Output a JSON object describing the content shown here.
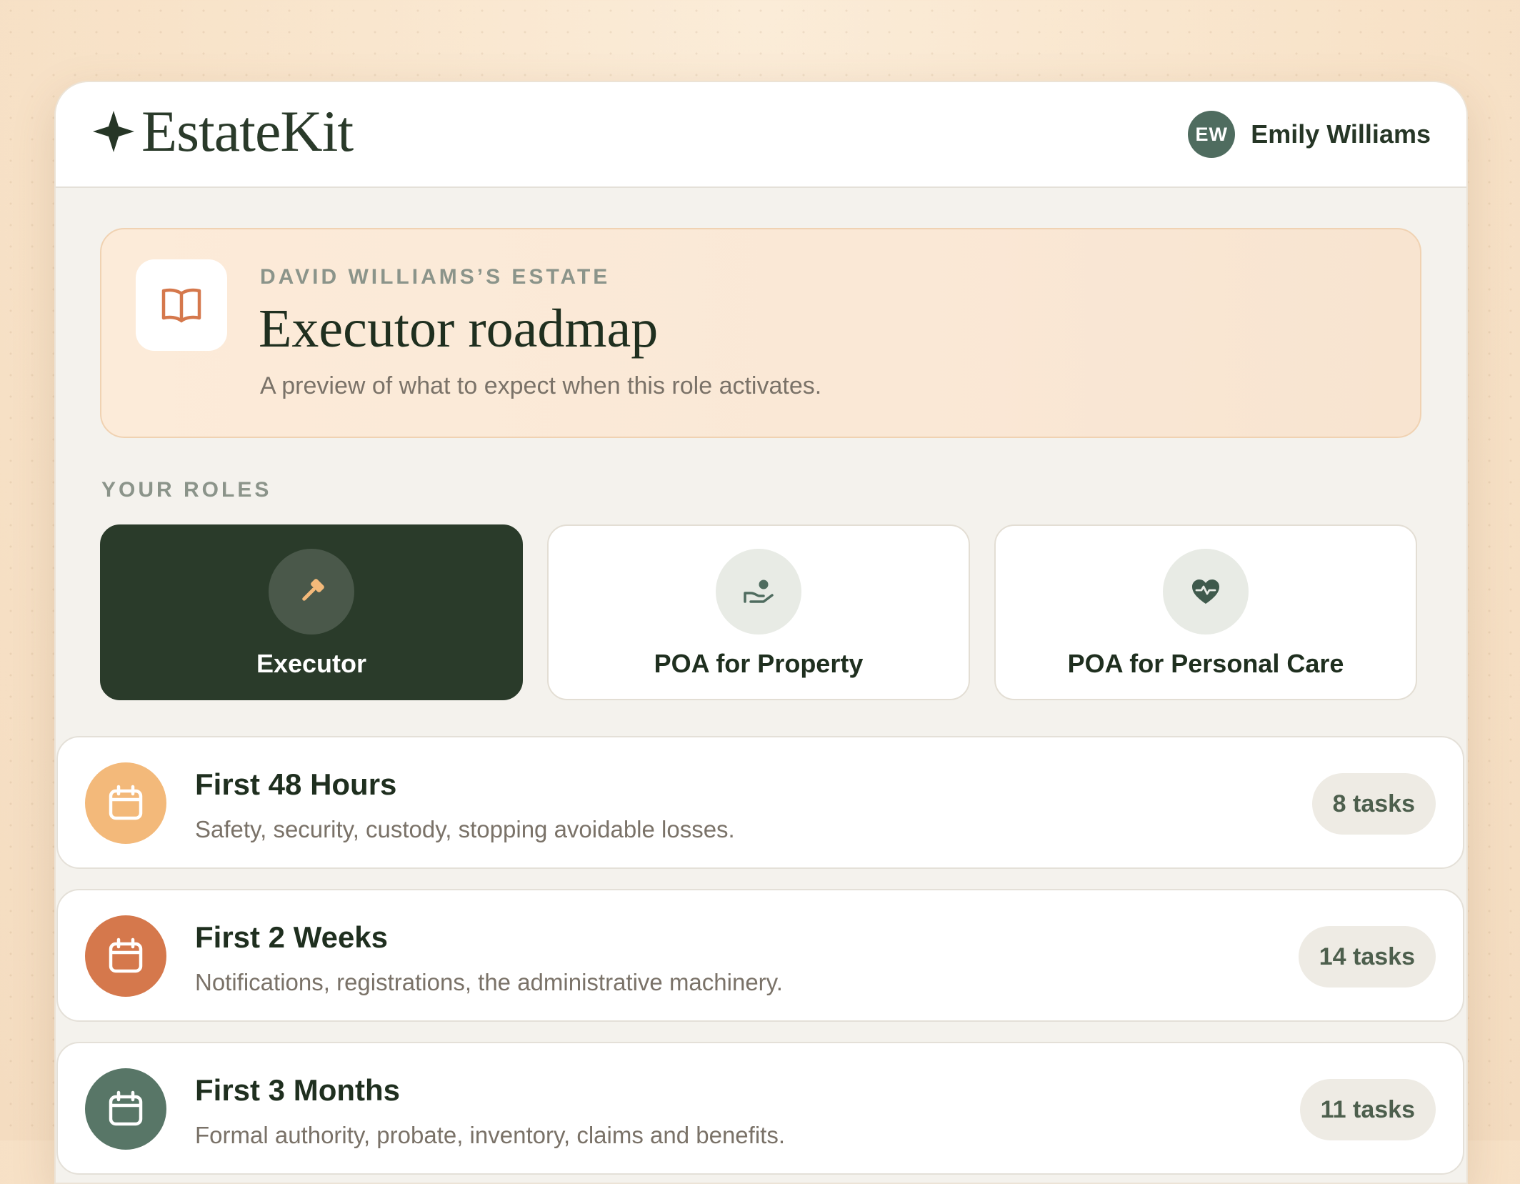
{
  "app": {
    "brand_name": "EstateKit",
    "user": {
      "initials": "EW",
      "name": "Emily Williams"
    }
  },
  "hero": {
    "eyebrow": "DAVID WILLIAMS’S ESTATE",
    "title": "Executor roadmap",
    "subtitle": "A preview of what to expect when this role activates.",
    "icon": "book-open-icon"
  },
  "roles": {
    "section_label": "YOUR ROLES",
    "items": [
      {
        "label": "Executor",
        "icon": "gavel-icon",
        "active": true
      },
      {
        "label": "POA for Property",
        "icon": "hand-coin-icon",
        "active": false
      },
      {
        "label": "POA for Personal Care",
        "icon": "heart-pulse-icon",
        "active": false
      }
    ]
  },
  "phases": [
    {
      "title": "First 48 Hours",
      "description": "Safety, security, custody, stopping avoidable losses.",
      "badge": "8 tasks",
      "icon": "calendar-icon",
      "color": "#f3b97a"
    },
    {
      "title": "First 2 Weeks",
      "description": "Notifications, registrations, the administrative machinery.",
      "badge": "14 tasks",
      "icon": "calendar-icon",
      "color": "#d5784c"
    },
    {
      "title": "First 3 Months",
      "description": "Formal authority, probate, inventory, claims and benefits.",
      "badge": "11 tasks",
      "icon": "calendar-icon",
      "color": "#587667"
    }
  ],
  "colors": {
    "brand_dark": "#2a3b2a",
    "accent_orange": "#d5784c",
    "accent_peach": "#f3b97a",
    "accent_green": "#587667"
  }
}
